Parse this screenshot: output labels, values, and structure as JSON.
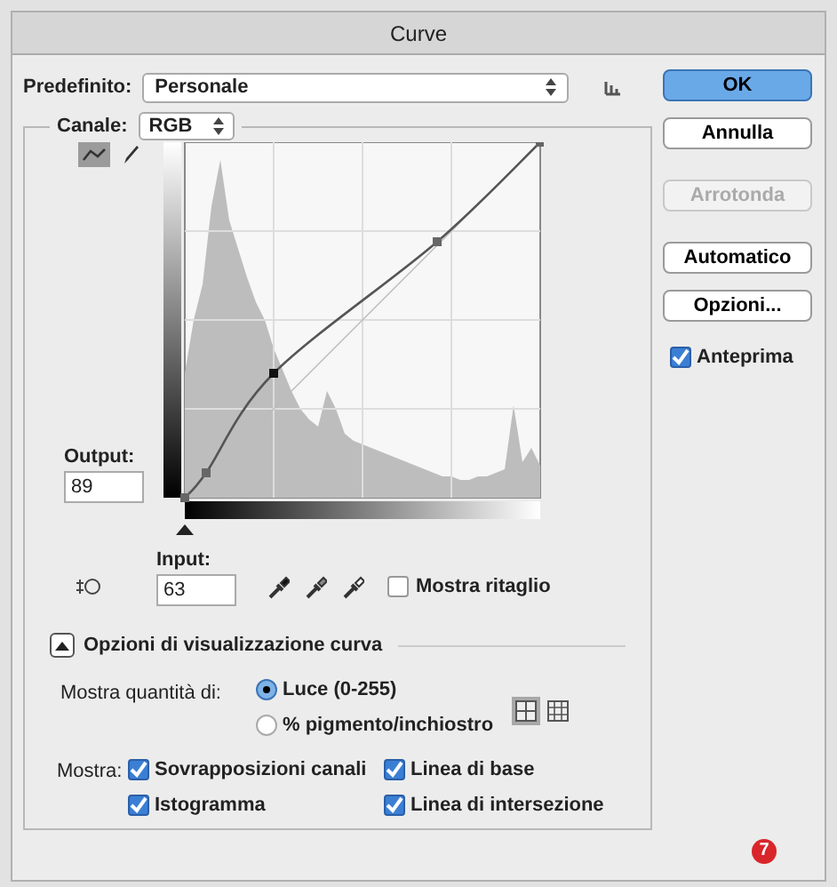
{
  "window": {
    "title": "Curve"
  },
  "preset": {
    "label": "Predefinito:",
    "value": "Personale"
  },
  "channel": {
    "label": "Canale:",
    "value": "RGB"
  },
  "curve_tools": [
    {
      "kind": "curve",
      "selected": true
    },
    {
      "kind": "pencil",
      "selected": false
    }
  ],
  "output": {
    "label": "Output:",
    "value": "89"
  },
  "input": {
    "label": "Input:",
    "value": "63"
  },
  "show_clipping": {
    "label": "Mostra ritaglio",
    "checked": false
  },
  "display_options": {
    "label": "Opzioni di visualizzazione curva",
    "expanded": true
  },
  "show_amount": {
    "label": "Mostra quantità di:",
    "options": [
      {
        "label": "Luce (0-255)",
        "selected": true
      },
      {
        "label": "% pigmento/inchiostro",
        "selected": false
      }
    ]
  },
  "grid_size": [
    {
      "kind": "coarse",
      "selected": true
    },
    {
      "kind": "fine",
      "selected": false
    }
  ],
  "show": {
    "label": "Mostra:",
    "options": [
      {
        "label": "Sovrapposizioni canali",
        "checked": true
      },
      {
        "label": "Linea di base",
        "checked": true
      },
      {
        "label": "Istogramma",
        "checked": true
      },
      {
        "label": "Linea di intersezione",
        "checked": true
      }
    ]
  },
  "buttons": [
    {
      "label": "OK",
      "kind": "default",
      "disabled": false
    },
    {
      "label": "Annulla",
      "kind": "normal",
      "disabled": false
    },
    {
      "label": "Arrotonda",
      "kind": "normal",
      "disabled": true
    },
    {
      "label": "Automatico",
      "kind": "normal",
      "disabled": false
    },
    {
      "label": "Opzioni...",
      "kind": "normal",
      "disabled": false
    }
  ],
  "preview": {
    "label": "Anteprima",
    "checked": true
  },
  "callout": "7"
}
